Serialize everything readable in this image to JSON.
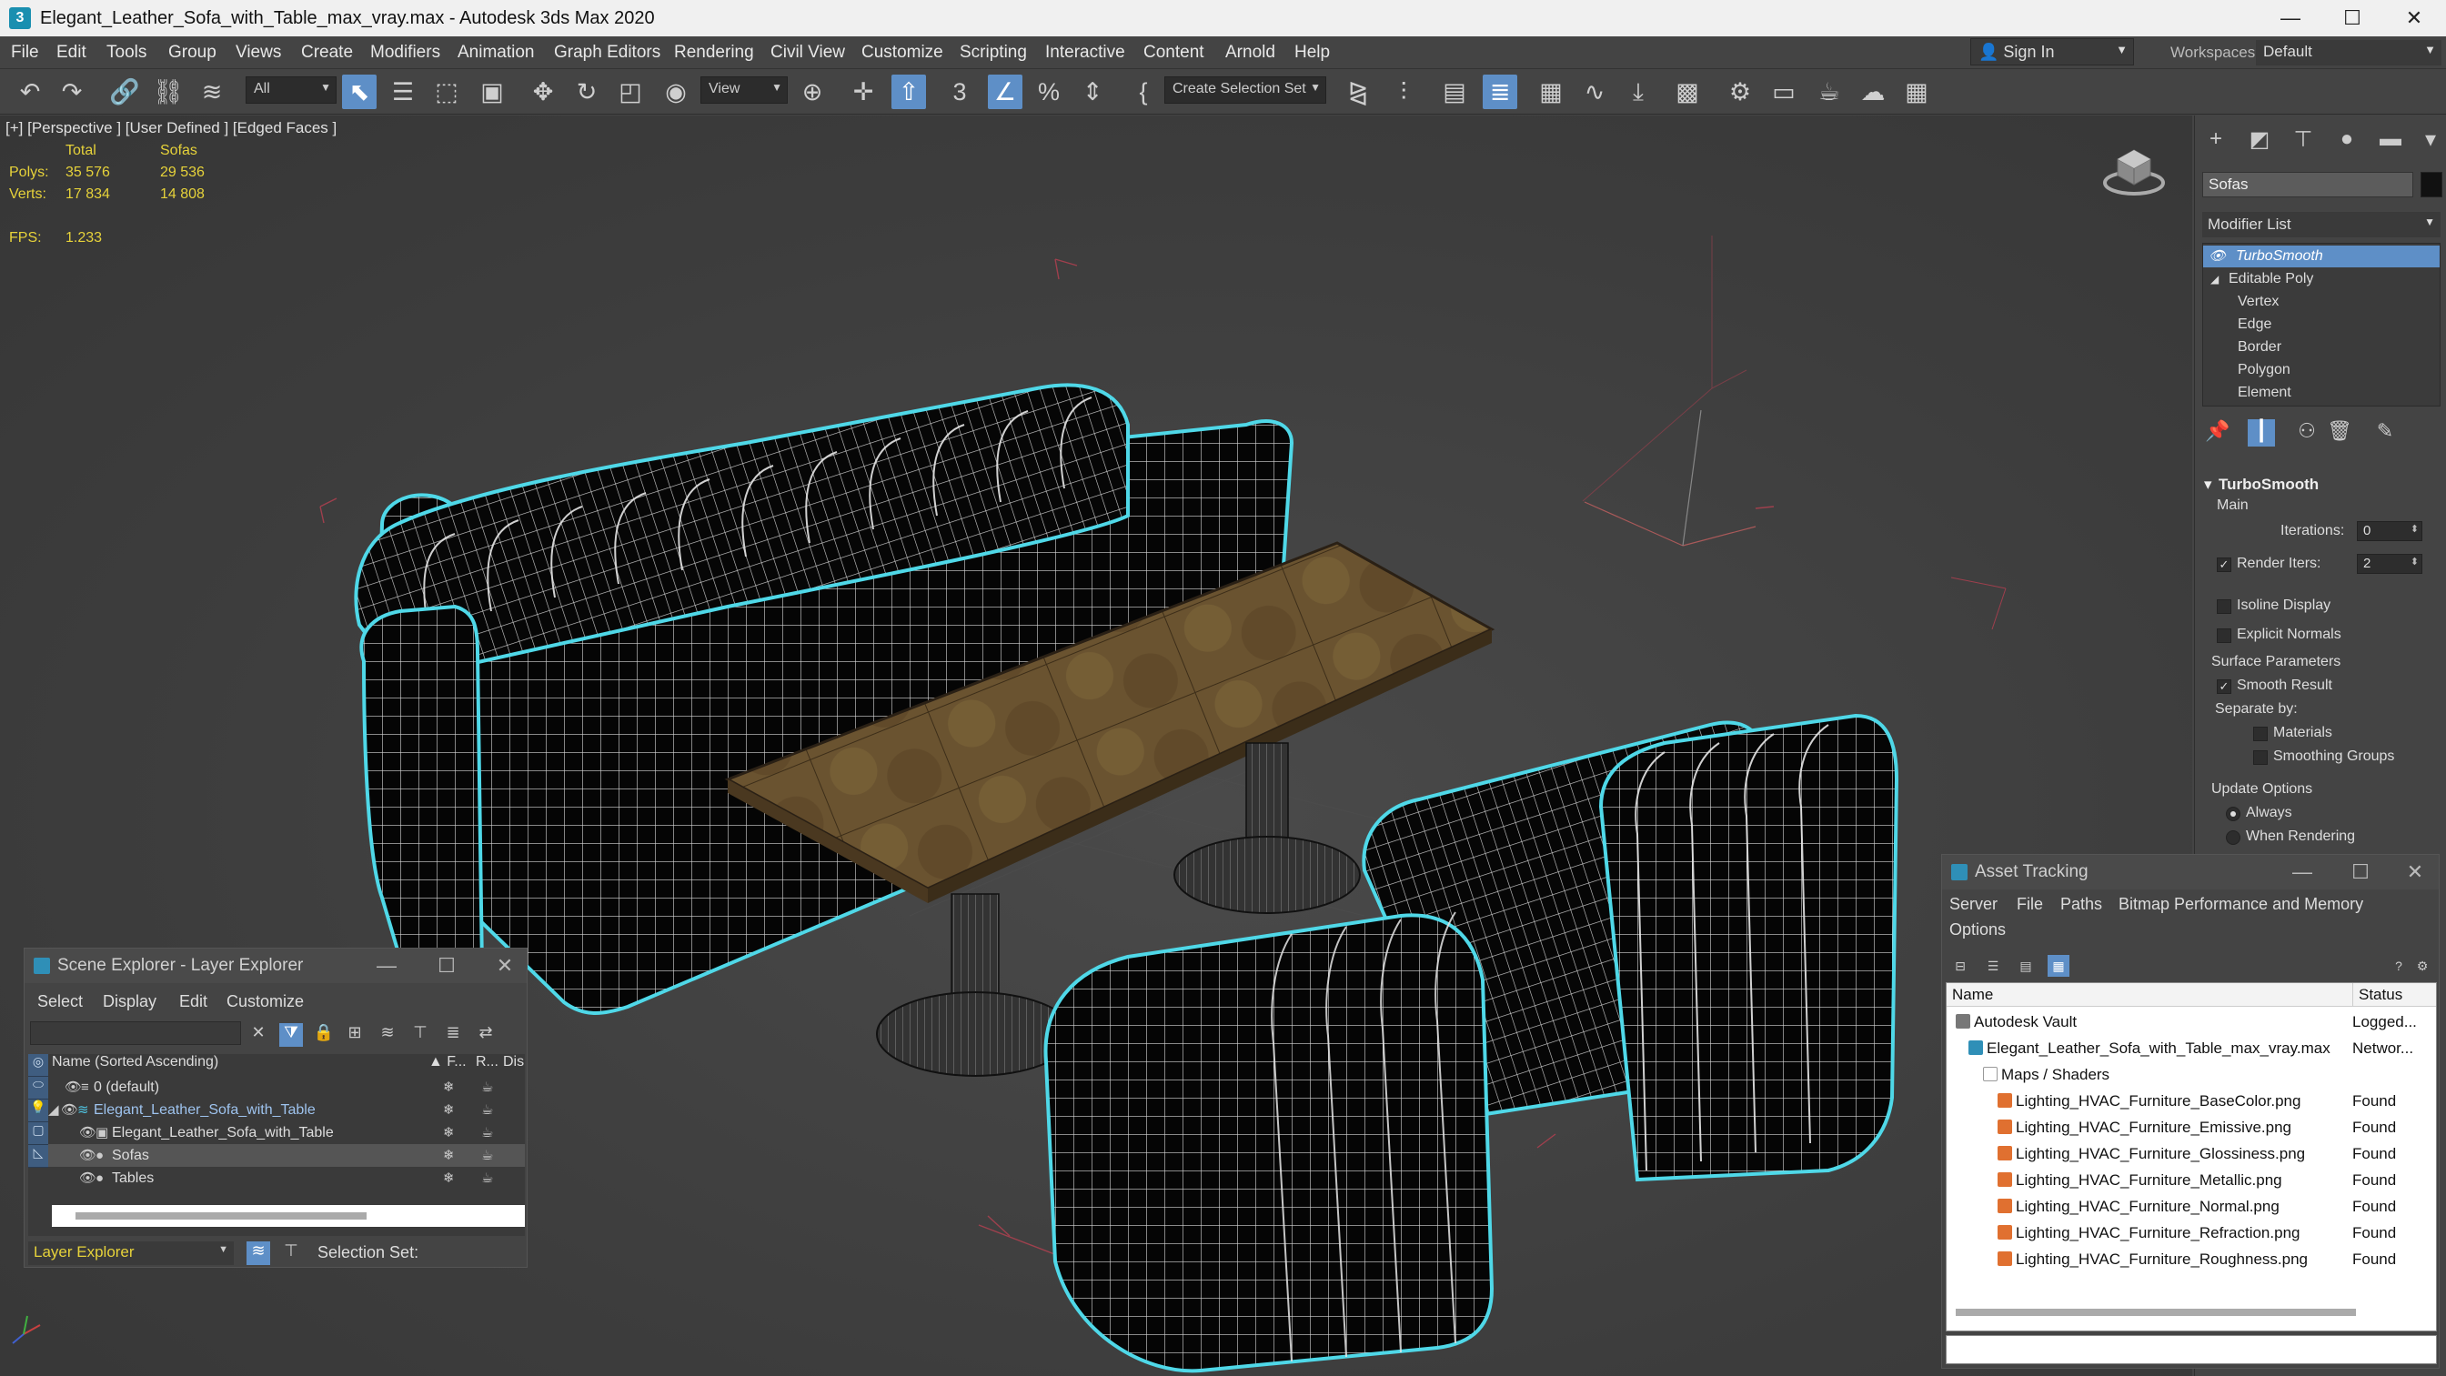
{
  "window": {
    "title": "Elegant_Leather_Sofa_with_Table_max_vray.max - Autodesk 3ds Max 2020",
    "app_icon": "3",
    "minimize": "—",
    "maximize": "☐",
    "close": "✕"
  },
  "menubar": {
    "items": [
      "File",
      "Edit",
      "Tools",
      "Group",
      "Views",
      "Create",
      "Modifiers",
      "Animation",
      "Graph Editors",
      "Rendering",
      "Civil View",
      "Customize",
      "Scripting",
      "Interactive",
      "Content",
      "Arnold",
      "Help"
    ],
    "sign_in": "Sign In",
    "workspaces_label": "Workspaces:",
    "workspace_value": "Default"
  },
  "toolbar": {
    "selection_filter": "All",
    "ref_coord": "View",
    "selection_set": "Create Selection Set"
  },
  "viewport": {
    "label": "[+] [Perspective ] [User Defined ] [Edged Faces ]",
    "stats": {
      "col_total": "Total",
      "col_sofas": "Sofas",
      "polys_label": "Polys:",
      "polys_total": "35 576",
      "polys_sofas": "29 536",
      "verts_label": "Verts:",
      "verts_total": "17 834",
      "verts_sofas": "14 808",
      "fps_label": "FPS:",
      "fps_value": "1.233"
    }
  },
  "command_panel": {
    "object_name": "Sofas",
    "modifier_list": "Modifier List",
    "stack": [
      "TurboSmooth",
      "Editable Poly",
      "Vertex",
      "Edge",
      "Border",
      "Polygon",
      "Element"
    ],
    "turbosmooth": {
      "title": "TurboSmooth",
      "main": "Main",
      "iterations_label": "Iterations:",
      "iterations": "0",
      "render_iters_label": "Render Iters:",
      "render_iters": "2",
      "isoline": "Isoline Display",
      "explicit_normals": "Explicit Normals",
      "surface_params": "Surface Parameters",
      "smooth_result": "Smooth Result",
      "separate_by": "Separate by:",
      "materials": "Materials",
      "smoothing_groups": "Smoothing Groups",
      "update_options": "Update Options",
      "always": "Always",
      "when_rendering": "When Rendering"
    }
  },
  "scene_explorer": {
    "title": "Scene Explorer - Layer Explorer",
    "menus": [
      "Select",
      "Display",
      "Edit",
      "Customize"
    ],
    "col_name": "Name (Sorted Ascending)",
    "col_f": "▲ F...",
    "col_r": "R...",
    "col_dis": "Dis",
    "rows": [
      {
        "name": "0 (default)"
      },
      {
        "name": "Elegant_Leather_Sofa_with_Table"
      },
      {
        "name": "Elegant_Leather_Sofa_with_Table"
      },
      {
        "name": "Sofas"
      },
      {
        "name": "Tables"
      }
    ],
    "footer_layer": "Layer Explorer",
    "selection_set_label": "Selection Set:"
  },
  "asset_tracking": {
    "title": "Asset Tracking",
    "menus": [
      "Server",
      "File",
      "Paths",
      "Bitmap Performance and Memory",
      "Options"
    ],
    "col_name": "Name",
    "col_status": "Status",
    "rows": [
      {
        "name": "Autodesk Vault",
        "status": "Logged..."
      },
      {
        "name": "Elegant_Leather_Sofa_with_Table_max_vray.max",
        "status": "Networ..."
      },
      {
        "name": "Maps / Shaders",
        "status": ""
      },
      {
        "name": "Lighting_HVAC_Furniture_BaseColor.png",
        "status": "Found"
      },
      {
        "name": "Lighting_HVAC_Furniture_Emissive.png",
        "status": "Found"
      },
      {
        "name": "Lighting_HVAC_Furniture_Glossiness.png",
        "status": "Found"
      },
      {
        "name": "Lighting_HVAC_Furniture_Metallic.png",
        "status": "Found"
      },
      {
        "name": "Lighting_HVAC_Furniture_Normal.png",
        "status": "Found"
      },
      {
        "name": "Lighting_HVAC_Furniture_Refraction.png",
        "status": "Found"
      },
      {
        "name": "Lighting_HVAC_Furniture_Roughness.png",
        "status": "Found"
      }
    ]
  },
  "colors": {
    "accent": "#5e8fc7",
    "selection_outline": "#4fd8e8",
    "stats_text": "#e6d23a",
    "table_top": "#6a5330"
  }
}
